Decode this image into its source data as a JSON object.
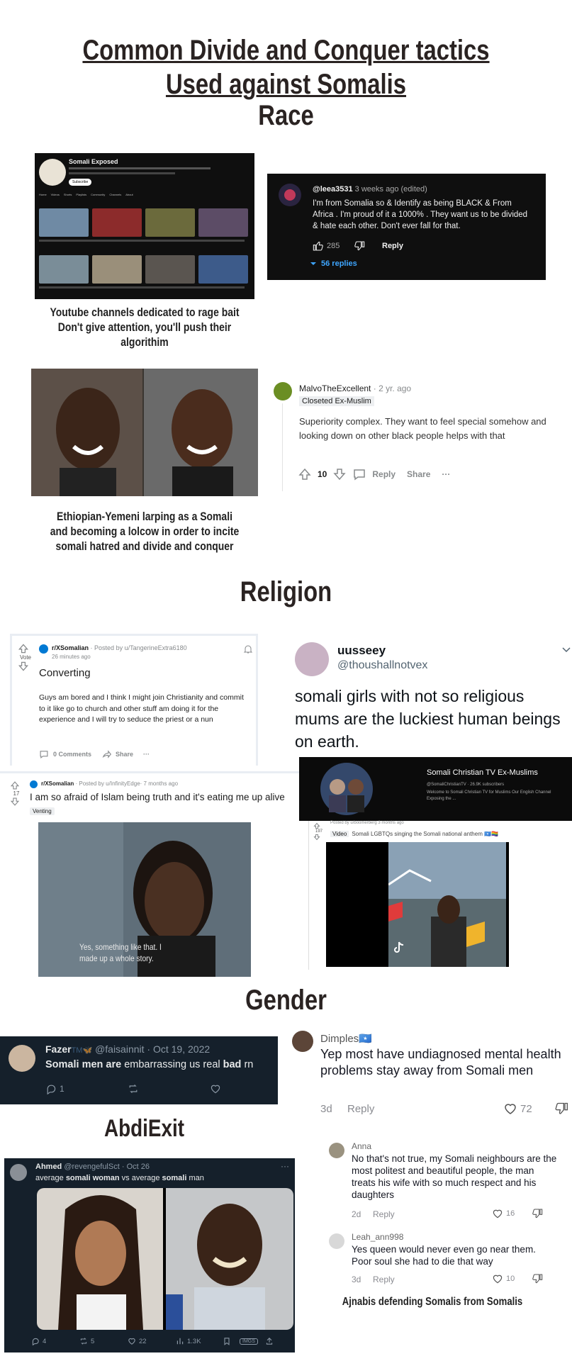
{
  "header": {
    "title_line1": "Common Divide and Conquer tactics",
    "title_line2": "Used against Somalis"
  },
  "sections": {
    "race": "Race",
    "religion": "Religion",
    "gender": "Gender",
    "abdiexit": "AbdiExit"
  },
  "race": {
    "youtube_channel": {
      "name": "Somali Exposed",
      "subscribe_label": "Subscribe",
      "tabs": [
        "Home",
        "Videos",
        "Shorts",
        "Playlists",
        "Community",
        "Channels",
        "About"
      ],
      "caption": "Youtube channels dedicated to rage bait Don't give attention, you'll push their algorithim"
    },
    "yt_comment": {
      "handle": "@leea3531",
      "time": "3 weeks ago (edited)",
      "text": "I'm from Somalia so & Identify as being BLACK & From Africa . I'm proud of it a 1000% . They want us to be divided & hate each other. Don't ever fall for that.",
      "likes": "285",
      "reply_label": "Reply",
      "replies_label": "56 replies"
    },
    "larp_caption": "Ethiopian-Yemeni larping as a Somali and becoming a lolcow in order to incite somali hatred and divide and conquer",
    "reddit_comment": {
      "user": "MalvoTheExcellent",
      "time": "· 2 yr. ago",
      "flair": "Closeted Ex-Muslim",
      "text": "Superiority complex. They want to feel special somehow and looking down on other black people helps with that",
      "votes": "10",
      "reply_label": "Reply",
      "share_label": "Share",
      "more_label": "···"
    }
  },
  "religion": {
    "reddit_post1": {
      "vote_label": "Vote",
      "sub": "r/XSomalian",
      "posted_by": "· Posted by u/TangerineExtra6180",
      "time": "26 minutes ago",
      "title": "Converting",
      "body": "Guys am bored and I think I might join Christianity and commit to it like go to church and other stuff am doing it for the experience and I will try to seduce the priest or a nun",
      "comments_label": "0 Comments",
      "share_label": "Share",
      "more_label": "···"
    },
    "tweet1": {
      "name": "uusseey",
      "handle": "@thoushallnotvex",
      "text": "somali girls with not so religious mums are the luckiest human beings on earth."
    },
    "reddit_post2": {
      "votes": "17",
      "sub": "r/XSomalian",
      "posted_by": "· Posted by u/InfinityEdge· 7 months ago",
      "title": "I am so afraid of Islam being truth and it's eating me up alive",
      "flair": "Venting"
    },
    "christian_channel": {
      "name": "Somali Christian TV Ex-Muslims",
      "meta": "@SomaliChristianTV · 26.9K subscribers",
      "desc": "Welcome to Somali Christian TV for Muslims Our English Channel Exposing the ..."
    },
    "video_caption": "Yes, something like that. I made up a whole story.",
    "reddit_post3": {
      "votes": "197",
      "posted_by": "Posted by u/boomerberg 3 months ago",
      "tag": "Video",
      "title": "Somali LGBTQs singing the Somali national anthem 🇸🇴🏳️‍🌈"
    }
  },
  "gender": {
    "tweet2": {
      "name": "Fazer",
      "name_suffix": "TM🦋",
      "handle": "@faisainnit",
      "date": "· Oct 19, 2022",
      "text_bold1": "Somali men are",
      "text_mid": " embarrassing us real ",
      "text_bold2": "bad",
      "text_end": " rn",
      "replies": "1"
    },
    "tiktok": {
      "main": {
        "name": "Dimples🇸🇴",
        "text": "Yep most have undiagnosed mental health problems stay away from Somali men",
        "time": "3d",
        "reply_label": "Reply",
        "likes": "72"
      },
      "reply1": {
        "name": "Anna",
        "text": "No that's not true, my Somali neighbours are the most politest and beautiful people, the man treats his wife with so much respect and his daughters",
        "time": "2d",
        "reply_label": "Reply",
        "likes": "16"
      },
      "reply2": {
        "name": "Leah_ann998",
        "text": "Yes queen would never even go near them. Poor soul she had to die that way",
        "time": "3d",
        "reply_label": "Reply",
        "likes": "10"
      },
      "caption": "Ajnabis defending Somalis from Somalis"
    }
  },
  "abdiexit": {
    "tweet3": {
      "name": "Ahmed",
      "handle": "@revengefulSct",
      "date": "· Oct 26",
      "text_pre": "average ",
      "text_bold1": "somali woman",
      "text_mid": " vs average ",
      "text_bold2": "somali",
      "text_end": " man",
      "more_label": "···",
      "replies": "4",
      "retweets": "5",
      "likes": "22",
      "views": "1.3K",
      "imgs_label": "IMGS"
    }
  },
  "colors": {
    "heading": "#2a2322",
    "yt_dark": "#0f0f0f",
    "yt_blue": "#3ea6ff",
    "twitter_dark": "#15202b",
    "reddit_gray": "#878a8c"
  }
}
